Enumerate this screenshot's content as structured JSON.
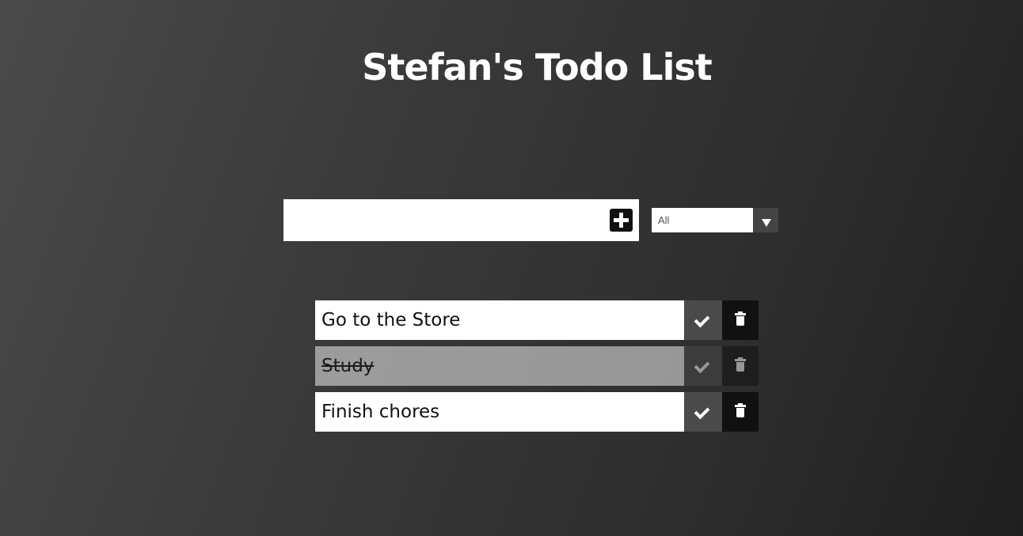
{
  "header": {
    "title": "Stefan's Todo List"
  },
  "form": {
    "input_value": "",
    "add_icon": "plus-icon"
  },
  "filter": {
    "selected": "All",
    "arrow_icon": "caret-down-icon"
  },
  "todos": [
    {
      "text": "Go to the Store",
      "completed": false,
      "complete_icon": "check-icon",
      "delete_icon": "trash-icon"
    },
    {
      "text": "Study",
      "completed": true,
      "complete_icon": "check-icon",
      "delete_icon": "trash-icon"
    },
    {
      "text": "Finish chores",
      "completed": false,
      "complete_icon": "check-icon",
      "delete_icon": "trash-icon"
    }
  ],
  "colors": {
    "background_light": "#4a4a4a",
    "background_dark": "#1f1f1f",
    "complete_button": "#4a4a4a",
    "trash_button": "#111111",
    "item_background": "#ffffff"
  }
}
